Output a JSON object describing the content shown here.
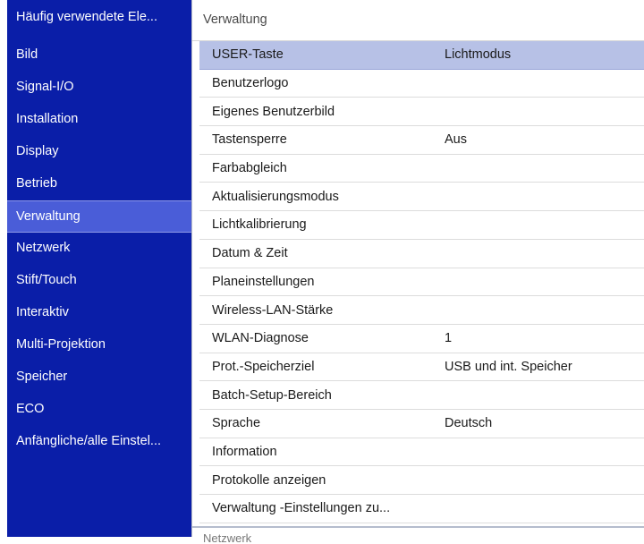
{
  "sidebar": {
    "items": [
      {
        "label": "Häufig verwendete Ele..."
      },
      {
        "label": "Bild"
      },
      {
        "label": "Signal-I/O"
      },
      {
        "label": "Installation"
      },
      {
        "label": "Display"
      },
      {
        "label": "Betrieb"
      },
      {
        "label": "Verwaltung"
      },
      {
        "label": "Netzwerk"
      },
      {
        "label": "Stift/Touch"
      },
      {
        "label": "Interaktiv"
      },
      {
        "label": "Multi-Projektion"
      },
      {
        "label": "Speicher"
      },
      {
        "label": "ECO"
      },
      {
        "label": "Anfängliche/alle Einstel..."
      }
    ],
    "selected": "Verwaltung"
  },
  "main": {
    "section_title": "Verwaltung",
    "rows": [
      {
        "label": "USER-Taste",
        "value": "Lichtmodus"
      },
      {
        "label": "Benutzerlogo",
        "value": ""
      },
      {
        "label": "Eigenes Benutzerbild",
        "value": ""
      },
      {
        "label": "Tastensperre",
        "value": "Aus"
      },
      {
        "label": "Farbabgleich",
        "value": ""
      },
      {
        "label": "Aktualisierungsmodus",
        "value": ""
      },
      {
        "label": "Lichtkalibrierung",
        "value": ""
      },
      {
        "label": "Datum & Zeit",
        "value": ""
      },
      {
        "label": "Planeinstellungen",
        "value": ""
      },
      {
        "label": "Wireless-LAN-Stärke",
        "value": ""
      },
      {
        "label": "WLAN-Diagnose",
        "value": "1"
      },
      {
        "label": "Prot.-Speicherziel",
        "value": "USB und int. Speicher"
      },
      {
        "label": "Batch-Setup-Bereich",
        "value": ""
      },
      {
        "label": "Sprache",
        "value": "Deutsch"
      },
      {
        "label": "Information",
        "value": ""
      },
      {
        "label": "Protokolle anzeigen",
        "value": ""
      },
      {
        "label": "Verwaltung -Einstellungen zu...",
        "value": ""
      }
    ],
    "selected_row": "USER-Taste",
    "next_section_title": "Netzwerk"
  },
  "colors": {
    "sidebar_bg": "#0a1ea8",
    "sidebar_selected_bg": "#4a5dd8",
    "row_selected_bg": "#b7c1e6"
  }
}
